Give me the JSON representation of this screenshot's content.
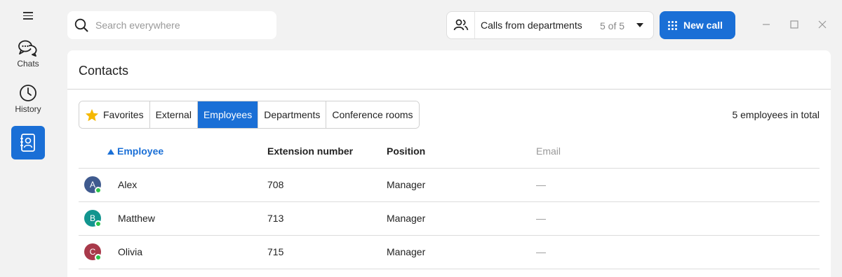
{
  "sidebar": {
    "items": [
      {
        "label": "Chats",
        "icon": "chat-bubbles-icon"
      },
      {
        "label": "History",
        "icon": "clock-icon"
      },
      {
        "label": "",
        "icon": "contacts-book-icon",
        "active": true
      }
    ]
  },
  "search": {
    "placeholder": "Search everywhere",
    "value": ""
  },
  "dept_selector": {
    "label": "Calls from departments",
    "count": "5 of 5",
    "icon": "people-icon"
  },
  "new_call": {
    "label": "New call",
    "icon": "dialpad-icon"
  },
  "window_controls": [
    "minimize-icon",
    "maximize-icon",
    "close-icon"
  ],
  "panel": {
    "title": "Contacts"
  },
  "tabs": [
    {
      "label": "Favorites",
      "icon": "star-icon"
    },
    {
      "label": "External"
    },
    {
      "label": "Employees",
      "active": true
    },
    {
      "label": "Departments"
    },
    {
      "label": "Conference rooms"
    }
  ],
  "total": "5 employees in total",
  "table": {
    "columns": {
      "employee": "Employee",
      "extension": "Extension number",
      "position": "Position",
      "email": "Email"
    },
    "sort": {
      "column": "employee",
      "direction": "ascending"
    },
    "rows": [
      {
        "initial": "A",
        "name": "Alex",
        "extension": "708",
        "position": "Manager",
        "email": "—",
        "avatar_color": "#3f5a8e",
        "status": "online"
      },
      {
        "initial": "B",
        "name": "Matthew",
        "extension": "713",
        "position": "Manager",
        "email": "—",
        "avatar_color": "#12958f",
        "status": "online"
      },
      {
        "initial": "C",
        "name": "Olivia",
        "extension": "715",
        "position": "Manager",
        "email": "—",
        "avatar_color": "#a8394a",
        "status": "online"
      }
    ]
  },
  "colors": {
    "accent": "#1a6fd6",
    "online": "#2bc24a",
    "background": "#f2f2f2"
  }
}
